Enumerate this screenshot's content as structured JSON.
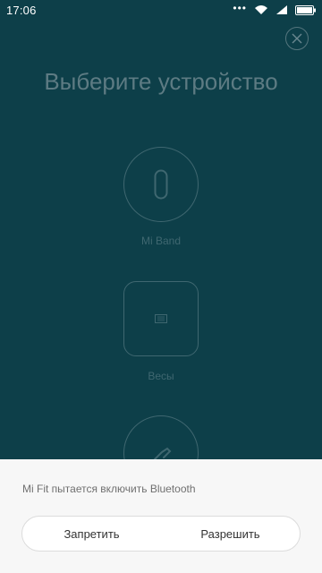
{
  "status_bar": {
    "time": "17:06",
    "icons": [
      "more-dots-icon",
      "wifi-icon",
      "signal-icon",
      "battery-icon"
    ]
  },
  "page": {
    "title": "Выберите устройство"
  },
  "devices": [
    {
      "label": "Mi Band",
      "icon": "band-icon"
    },
    {
      "label": "Весы",
      "icon": "scale-icon"
    },
    {
      "label": "",
      "icon": "shoe-icon"
    }
  ],
  "dialog": {
    "message": "Mi Fit пытается включить Bluetooth",
    "deny_label": "Запретить",
    "allow_label": "Разрешить"
  },
  "colors": {
    "background": "#0d3f49",
    "sheet": "#f7f7f7"
  }
}
